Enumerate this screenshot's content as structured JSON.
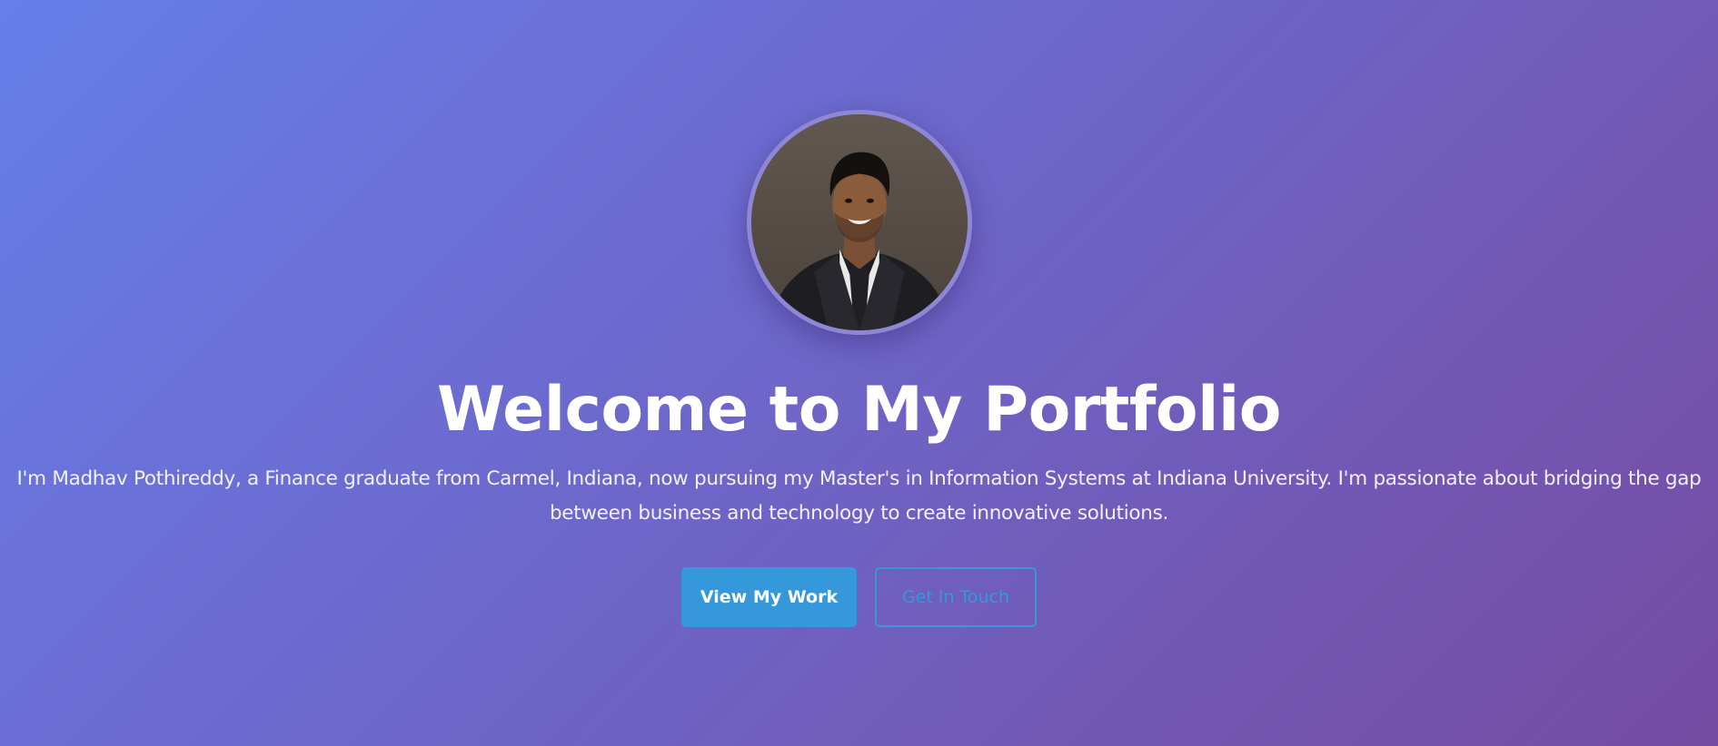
{
  "hero": {
    "title": "Welcome to My Portfolio",
    "intro": "I'm Madhav Pothireddy, a Finance graduate from Carmel, Indiana, now pursuing my Master's in Information Systems at Indiana University. I'm passionate about bridging the gap between business and technology to create innovative solutions.",
    "avatar_alt": "Madhav Pothireddy",
    "primary_button_label": "View My Work",
    "secondary_button_label": "Get In Touch"
  },
  "colors": {
    "gradient_start": "#667eea",
    "gradient_end": "#764ba2",
    "accent": "#3498db",
    "text": "#ffffff"
  }
}
